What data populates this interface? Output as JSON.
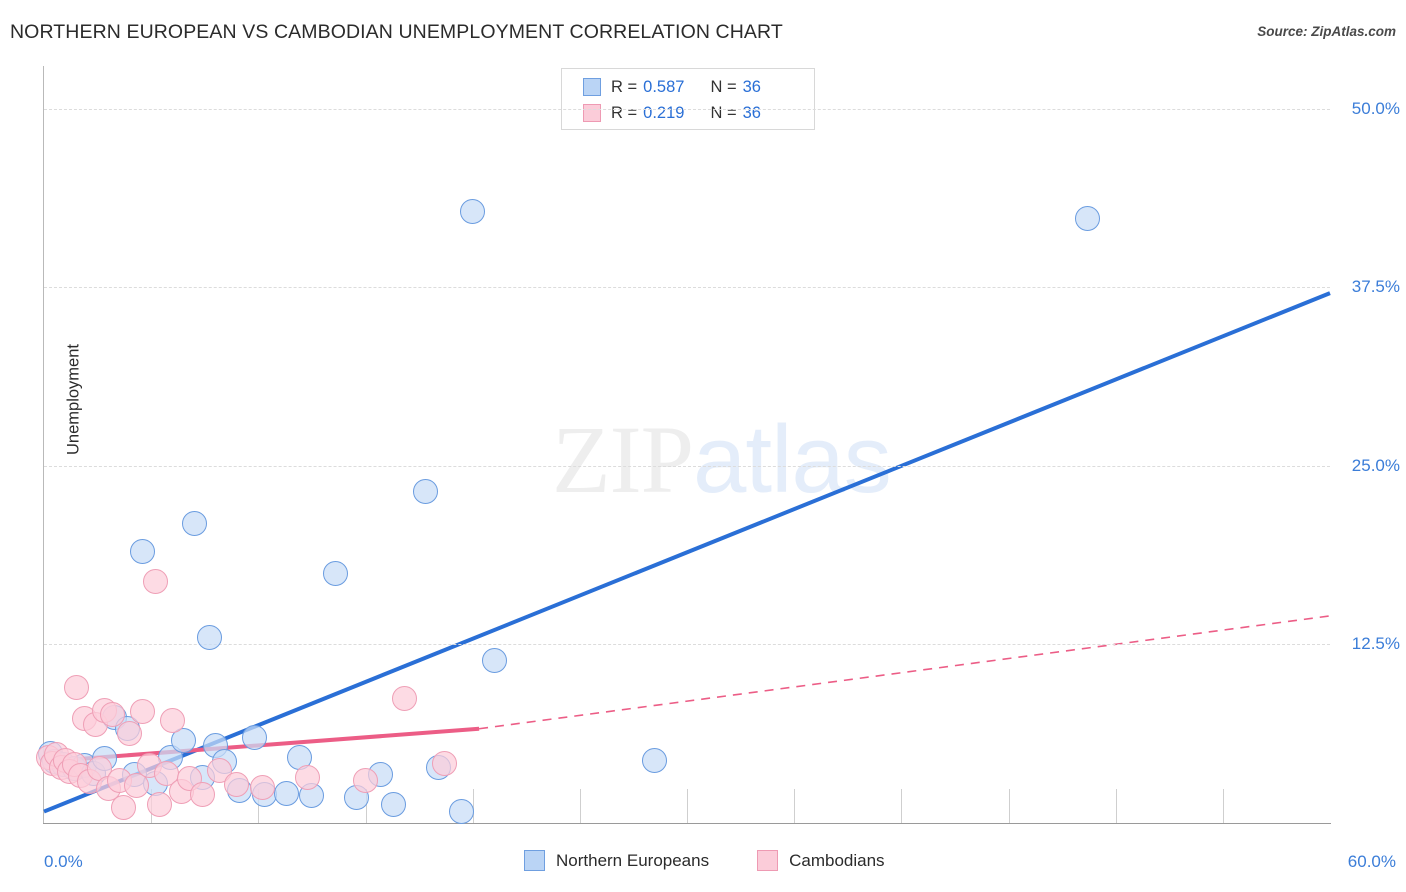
{
  "header": {
    "title": "NORTHERN EUROPEAN VS CAMBODIAN UNEMPLOYMENT CORRELATION CHART",
    "source": "Source: ZipAtlas.com"
  },
  "watermark": {
    "part1": "ZIP",
    "part2": "atlas"
  },
  "corr_legend": {
    "rows": [
      {
        "swatch": "blue",
        "r_label": "R =",
        "r_value": "0.587",
        "n_label": "N =",
        "n_value": "36"
      },
      {
        "swatch": "pink",
        "r_label": "R =",
        "r_value": "0.219",
        "n_label": "N =",
        "n_value": "36"
      }
    ]
  },
  "series_legend": {
    "items": [
      {
        "label": "Northern Europeans",
        "color": "#bad4f5"
      },
      {
        "label": "Cambodians",
        "color": "#fbccd9"
      }
    ]
  },
  "colors": {
    "blue_fill": "#c7ddf7",
    "blue_stroke": "#6a9ce0",
    "blue_line": "#2a6fd6",
    "pink_fill": "#fccdd9",
    "pink_stroke": "#ef9fb6",
    "pink_line": "#ec5d86",
    "axis_text": "#3b7dd8",
    "grid": "#dcdcdc"
  },
  "chart_data": {
    "type": "scatter",
    "title": "NORTHERN EUROPEAN VS CAMBODIAN UNEMPLOYMENT CORRELATION CHART",
    "xlabel": "",
    "ylabel": "Unemployment",
    "xlim": [
      0.0,
      60.0
    ],
    "ylim": [
      0.0,
      53.0
    ],
    "x_unit": "%",
    "y_unit": "%",
    "grid": true,
    "legend_position": "bottom-center",
    "x_ticks": [
      "0.0%",
      "60.0%"
    ],
    "x_tick_values": [
      0.0,
      60.0
    ],
    "y_ticks": [
      "12.5%",
      "25.0%",
      "37.5%",
      "50.0%"
    ],
    "y_tick_values": [
      12.5,
      25.0,
      37.5,
      50.0
    ],
    "series": [
      {
        "name": "Northern Europeans",
        "color": "#c7ddf7",
        "r": 0.587,
        "n": 36,
        "trendline": {
          "style": "solid",
          "x0": 0.0,
          "y0": 0.8,
          "x1": 60.0,
          "y1": 37.1
        },
        "points": [
          {
            "x": 0.3,
            "y": 4.9
          },
          {
            "x": 0.5,
            "y": 4.3
          },
          {
            "x": 0.9,
            "y": 4.1
          },
          {
            "x": 1.4,
            "y": 3.8
          },
          {
            "x": 1.9,
            "y": 4.0
          },
          {
            "x": 2.3,
            "y": 3.5
          },
          {
            "x": 2.8,
            "y": 4.5
          },
          {
            "x": 3.3,
            "y": 7.4
          },
          {
            "x": 3.9,
            "y": 6.6
          },
          {
            "x": 4.2,
            "y": 3.4
          },
          {
            "x": 4.6,
            "y": 19.0
          },
          {
            "x": 5.2,
            "y": 2.8
          },
          {
            "x": 5.9,
            "y": 4.6
          },
          {
            "x": 7.0,
            "y": 21.0
          },
          {
            "x": 7.4,
            "y": 3.2
          },
          {
            "x": 7.7,
            "y": 13.0
          },
          {
            "x": 8.0,
            "y": 5.4
          },
          {
            "x": 8.4,
            "y": 4.3
          },
          {
            "x": 9.1,
            "y": 2.3
          },
          {
            "x": 9.8,
            "y": 6.0
          },
          {
            "x": 10.3,
            "y": 2.0
          },
          {
            "x": 11.3,
            "y": 2.1
          },
          {
            "x": 11.9,
            "y": 4.6
          },
          {
            "x": 12.5,
            "y": 1.9
          },
          {
            "x": 13.6,
            "y": 17.5
          },
          {
            "x": 14.6,
            "y": 1.8
          },
          {
            "x": 15.7,
            "y": 3.4
          },
          {
            "x": 16.3,
            "y": 1.3
          },
          {
            "x": 17.8,
            "y": 23.2
          },
          {
            "x": 18.4,
            "y": 3.9
          },
          {
            "x": 19.5,
            "y": 0.8
          },
          {
            "x": 20.0,
            "y": 42.8
          },
          {
            "x": 21.0,
            "y": 11.4
          },
          {
            "x": 28.5,
            "y": 4.4
          },
          {
            "x": 48.7,
            "y": 42.3
          },
          {
            "x": 6.5,
            "y": 5.8
          }
        ]
      },
      {
        "name": "Cambodians",
        "color": "#fccdd9",
        "r": 0.219,
        "n": 36,
        "trendline": {
          "style_solid": "solid",
          "style_extension": "dashed",
          "x0": 0.0,
          "y0": 4.3,
          "x_split": 20.3,
          "y_split": 6.6,
          "x1": 60.0,
          "y1": 14.5
        },
        "points": [
          {
            "x": 0.2,
            "y": 4.6
          },
          {
            "x": 0.4,
            "y": 4.2
          },
          {
            "x": 0.6,
            "y": 4.8
          },
          {
            "x": 0.8,
            "y": 3.9
          },
          {
            "x": 1.0,
            "y": 4.4
          },
          {
            "x": 1.2,
            "y": 3.6
          },
          {
            "x": 1.4,
            "y": 4.1
          },
          {
            "x": 1.5,
            "y": 9.5
          },
          {
            "x": 1.7,
            "y": 3.3
          },
          {
            "x": 1.9,
            "y": 7.3
          },
          {
            "x": 2.1,
            "y": 2.9
          },
          {
            "x": 2.4,
            "y": 6.9
          },
          {
            "x": 2.6,
            "y": 3.8
          },
          {
            "x": 2.8,
            "y": 7.9
          },
          {
            "x": 3.0,
            "y": 2.4
          },
          {
            "x": 3.2,
            "y": 7.6
          },
          {
            "x": 3.5,
            "y": 3.0
          },
          {
            "x": 3.7,
            "y": 1.1
          },
          {
            "x": 4.0,
            "y": 6.3
          },
          {
            "x": 4.3,
            "y": 2.6
          },
          {
            "x": 4.6,
            "y": 7.8
          },
          {
            "x": 4.9,
            "y": 4.0
          },
          {
            "x": 5.2,
            "y": 16.9
          },
          {
            "x": 5.4,
            "y": 1.3
          },
          {
            "x": 5.7,
            "y": 3.5
          },
          {
            "x": 6.0,
            "y": 7.2
          },
          {
            "x": 6.4,
            "y": 2.2
          },
          {
            "x": 6.8,
            "y": 3.1
          },
          {
            "x": 7.4,
            "y": 2.0
          },
          {
            "x": 8.2,
            "y": 3.7
          },
          {
            "x": 9.0,
            "y": 2.7
          },
          {
            "x": 10.2,
            "y": 2.5
          },
          {
            "x": 12.3,
            "y": 3.2
          },
          {
            "x": 15.0,
            "y": 3.0
          },
          {
            "x": 18.7,
            "y": 4.2
          },
          {
            "x": 16.8,
            "y": 8.7
          }
        ]
      }
    ]
  }
}
